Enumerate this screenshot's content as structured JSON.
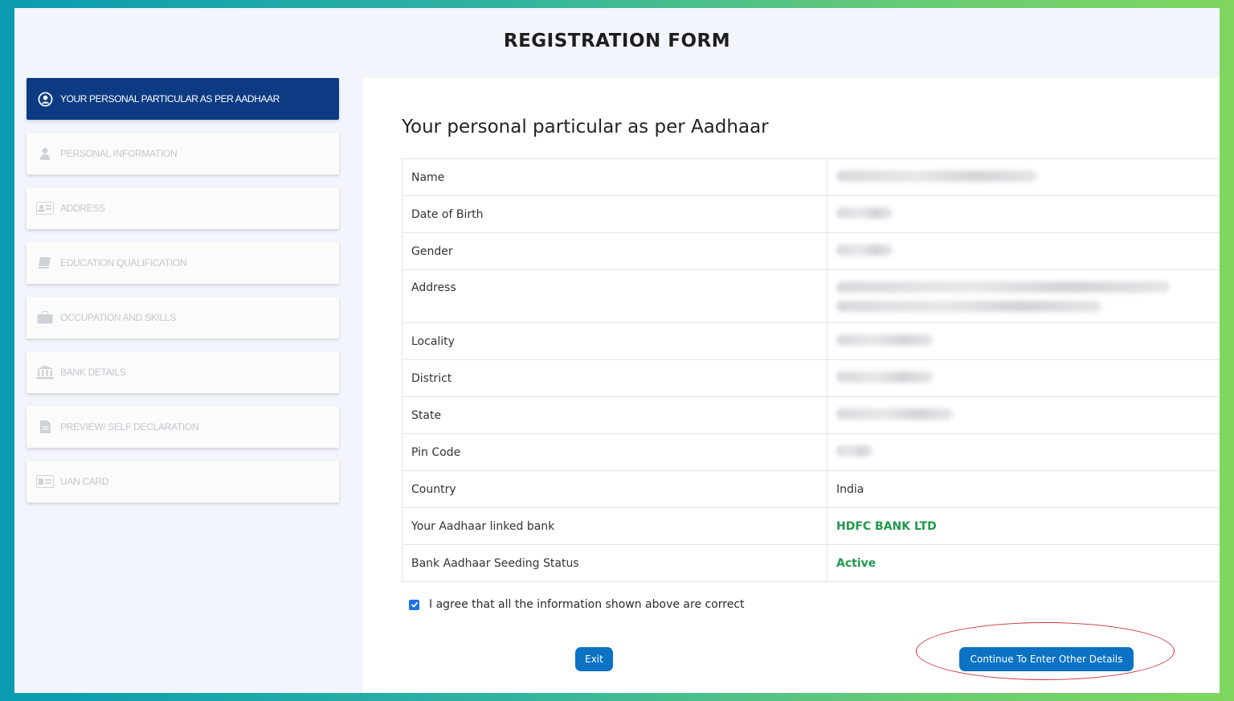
{
  "form_title": "REGISTRATION FORM",
  "sidebar": {
    "items": [
      {
        "label": "YOUR PERSONAL PARTICULAR AS PER AADHAAR",
        "icon": "user-circle-icon",
        "active": true
      },
      {
        "label": "PERSONAL INFORMATION",
        "icon": "person-icon",
        "active": false
      },
      {
        "label": "ADDRESS",
        "icon": "address-card-icon",
        "active": false
      },
      {
        "label": "EDUCATION QUALIFICATION",
        "icon": "book-icon",
        "active": false
      },
      {
        "label": "OCCUPATION AND SKILLS",
        "icon": "briefcase-icon",
        "active": false
      },
      {
        "label": "BANK DETAILS",
        "icon": "bank-icon",
        "active": false
      },
      {
        "label": "PREVIEW/ SELF DECLARATION",
        "icon": "document-icon",
        "active": false
      },
      {
        "label": "UAN CARD",
        "icon": "id-card-icon",
        "active": false
      }
    ]
  },
  "main": {
    "heading": "Your personal particular as per Aadhaar",
    "rows": [
      {
        "label": "Name",
        "value": null,
        "redacted": true
      },
      {
        "label": "Date of Birth",
        "value": null,
        "redacted": true
      },
      {
        "label": "Gender",
        "value": null,
        "redacted": true
      },
      {
        "label": "Address",
        "value": null,
        "redacted": true
      },
      {
        "label": "Locality",
        "value": null,
        "redacted": true
      },
      {
        "label": "District",
        "value": null,
        "redacted": true
      },
      {
        "label": "State",
        "value": null,
        "redacted": true
      },
      {
        "label": "Pin Code",
        "value": null,
        "redacted": true
      },
      {
        "label": "Country",
        "value": "India"
      },
      {
        "label": "Your Aadhaar linked bank",
        "value": "HDFC BANK LTD"
      },
      {
        "label": "Bank Aadhaar Seeding Status",
        "value": "Active"
      }
    ],
    "agree_text": "I agree that all the information shown above are correct",
    "agree_checked": true,
    "exit_label": "Exit",
    "continue_label": "Continue To Enter Other Details"
  },
  "colors": {
    "active_step": "#0d3b83",
    "button": "#0b72c4",
    "status_green": "#1f9a4a",
    "highlight_ring": "#c8303a"
  }
}
